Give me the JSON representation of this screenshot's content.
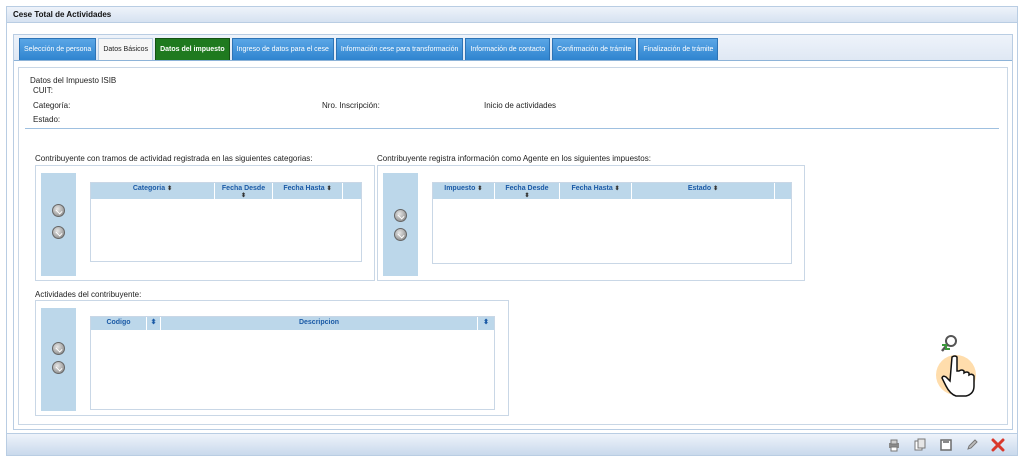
{
  "window": {
    "title": "Cese Total de Actividades"
  },
  "tabs": [
    {
      "label": "Selección de persona",
      "style": "blue"
    },
    {
      "label": "Datos Básicos",
      "style": "plain"
    },
    {
      "label": "Datos del impuesto",
      "style": "active"
    },
    {
      "label": "Ingreso de datos para el cese",
      "style": "blue"
    },
    {
      "label": "Información cese para transformación",
      "style": "blue"
    },
    {
      "label": "Información de contacto",
      "style": "blue"
    },
    {
      "label": "Confirmación de trámite",
      "style": "blue"
    },
    {
      "label": "Finalización de trámite",
      "style": "blue"
    }
  ],
  "impuesto": {
    "section_title": "Datos del Impuesto ISIB",
    "cuit_label": "CUIT:",
    "categoria_label": "Categoría:",
    "estado_label": "Estado:",
    "nro_inscripcion_label": "Nro. Inscripción:",
    "inicio_actividades_label": "Inicio de actividades"
  },
  "categorias_panel": {
    "title": "Contribuyente con tramos de actividad registrada en las siguientes categorias:",
    "columns": [
      "Categoria",
      "Fecha Desde",
      "Fecha Hasta"
    ]
  },
  "agente_panel": {
    "title": "Contribuyente registra información como Agente en los siguientes impuestos:",
    "columns": [
      "Impuesto",
      "Fecha Desde",
      "Fecha Hasta",
      "Estado"
    ]
  },
  "actividades_panel": {
    "title": "Actividades del contribuyente:",
    "columns": [
      "Codigo",
      "Descripcion"
    ]
  },
  "colors": {
    "tab_blue": "#2f84cf",
    "tab_active": "#1f7a1f",
    "grid_header": "#bcd7ea",
    "close_red": "#d9382b"
  },
  "icons": {
    "sort": "⬍",
    "toolbar": [
      "print-icon",
      "copy-icon",
      "save-icon",
      "edit-icon",
      "close-icon"
    ]
  }
}
